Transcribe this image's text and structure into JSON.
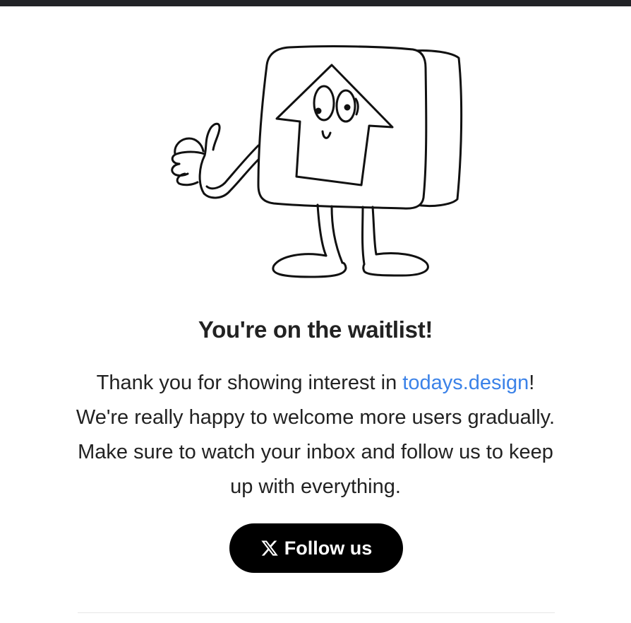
{
  "waitlist": {
    "title": "You're on the waitlist!",
    "message_before_link": "Thank you for showing interest in ",
    "link_text": "todays.design",
    "message_after_link": "! We're really happy to welcome more users gradually. Make sure to watch your inbox and follow us to keep up with everything."
  },
  "follow_button": {
    "label": "Follow us",
    "icon": "x-logo-icon"
  },
  "colors": {
    "link": "#3b82e8",
    "button_bg": "#000000",
    "top_bar": "#222327"
  }
}
